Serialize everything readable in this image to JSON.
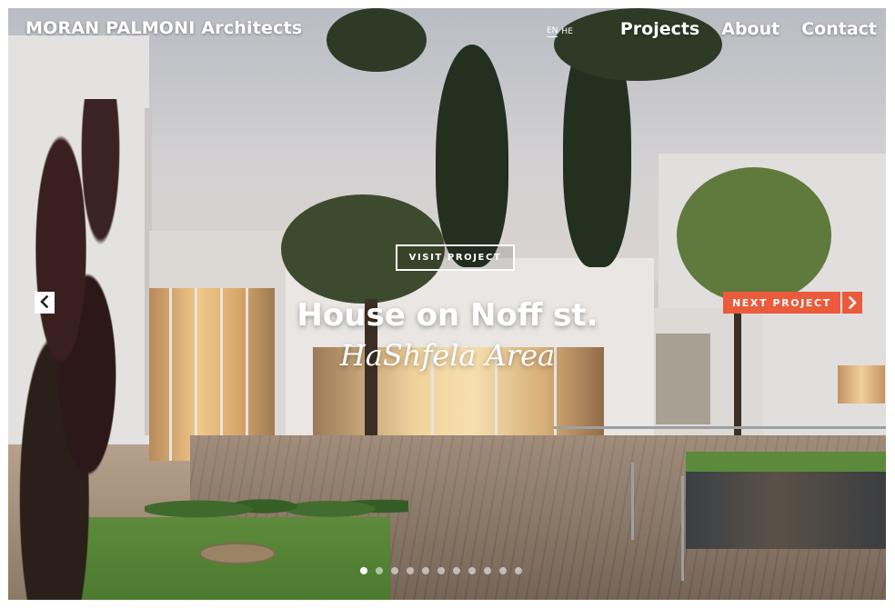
{
  "header": {
    "brand": "MORAN PALMONI Architects",
    "languages": [
      {
        "code": "EN",
        "active": true
      },
      {
        "code": "HE",
        "active": false
      }
    ],
    "nav": [
      "Projects",
      "About",
      "Contact"
    ]
  },
  "hero": {
    "visit_label": "VISIT PROJECT",
    "title": "House on Noff st.",
    "subtitle": "HaShfela Area",
    "next_label": "NEXT PROJECT"
  },
  "slider": {
    "total": 11,
    "active_index": 0
  },
  "colors": {
    "accent": "#ea5a3b",
    "text": "#ffffff"
  },
  "icons": {
    "prev": "chevron-left-icon",
    "next": "chevron-right-icon"
  }
}
